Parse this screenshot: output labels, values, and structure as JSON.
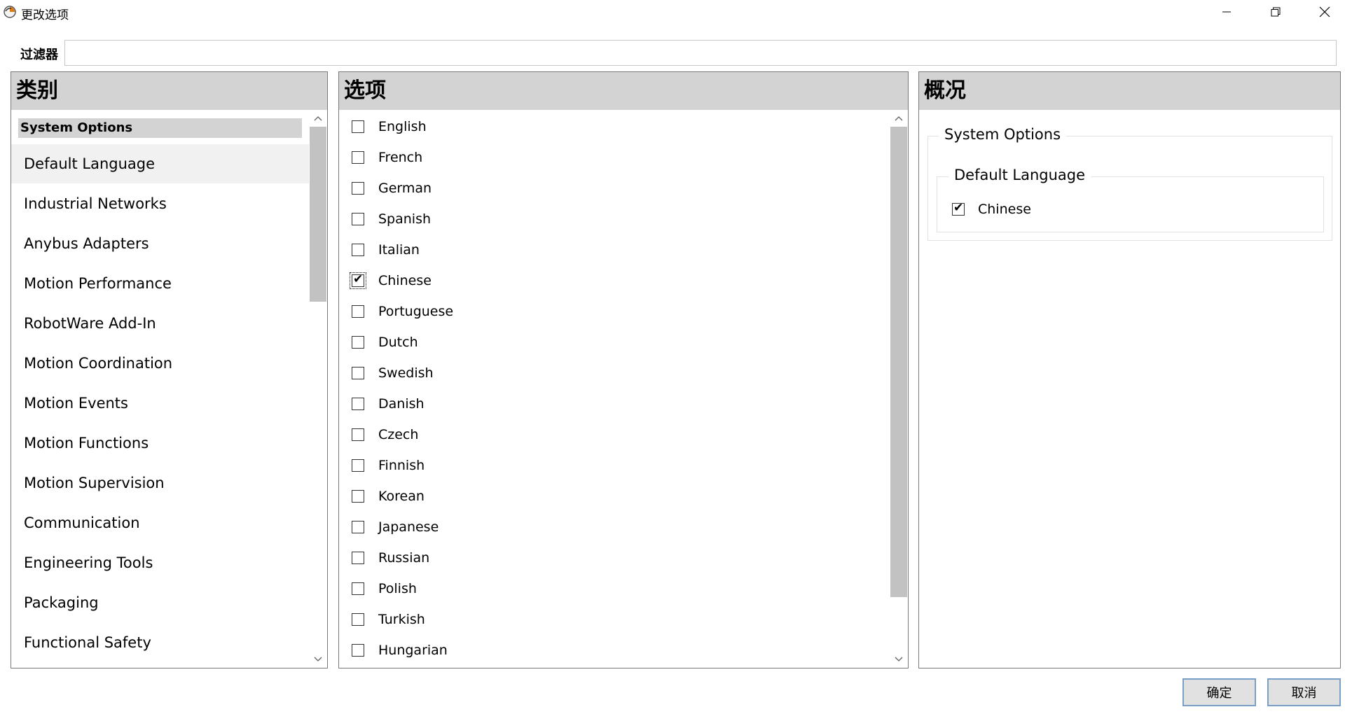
{
  "window": {
    "title": "更改选项",
    "icon": "app-logo-icon",
    "controls": [
      "minimize-icon",
      "restore-icon",
      "close-icon"
    ]
  },
  "filter": {
    "label": "过滤器",
    "value": "",
    "placeholder": ""
  },
  "categories": {
    "header": "类别",
    "group": "System Options",
    "items": [
      "Default Language",
      "Industrial Networks",
      "Anybus Adapters",
      "Motion Performance",
      "RobotWare Add-In",
      "Motion Coordination",
      "Motion Events",
      "Motion Functions",
      "Motion Supervision",
      "Communication",
      "Engineering Tools",
      "Packaging",
      "Functional Safety"
    ],
    "selected": "Default Language"
  },
  "options": {
    "header": "选项",
    "items": [
      {
        "label": "English",
        "checked": false
      },
      {
        "label": "French",
        "checked": false
      },
      {
        "label": "German",
        "checked": false
      },
      {
        "label": "Spanish",
        "checked": false
      },
      {
        "label": "Italian",
        "checked": false
      },
      {
        "label": "Chinese",
        "checked": true
      },
      {
        "label": "Portuguese",
        "checked": false
      },
      {
        "label": "Dutch",
        "checked": false
      },
      {
        "label": "Swedish",
        "checked": false
      },
      {
        "label": "Danish",
        "checked": false
      },
      {
        "label": "Czech",
        "checked": false
      },
      {
        "label": "Finnish",
        "checked": false
      },
      {
        "label": "Korean",
        "checked": false
      },
      {
        "label": "Japanese",
        "checked": false
      },
      {
        "label": "Russian",
        "checked": false
      },
      {
        "label": "Polish",
        "checked": false
      },
      {
        "label": "Turkish",
        "checked": false
      },
      {
        "label": "Hungarian",
        "checked": false
      }
    ]
  },
  "overview": {
    "header": "概况",
    "group": "System Options",
    "subgroup": "Default Language",
    "selected_item": "Chinese",
    "selected_checked": true
  },
  "buttons": {
    "ok": "确定",
    "cancel": "取消"
  },
  "colors": {
    "header_bg": "#d3d3d3",
    "selected_bg": "#f1f1f1",
    "button_border": "#7a9fc6",
    "scroll_thumb": "#c2c2c2"
  }
}
